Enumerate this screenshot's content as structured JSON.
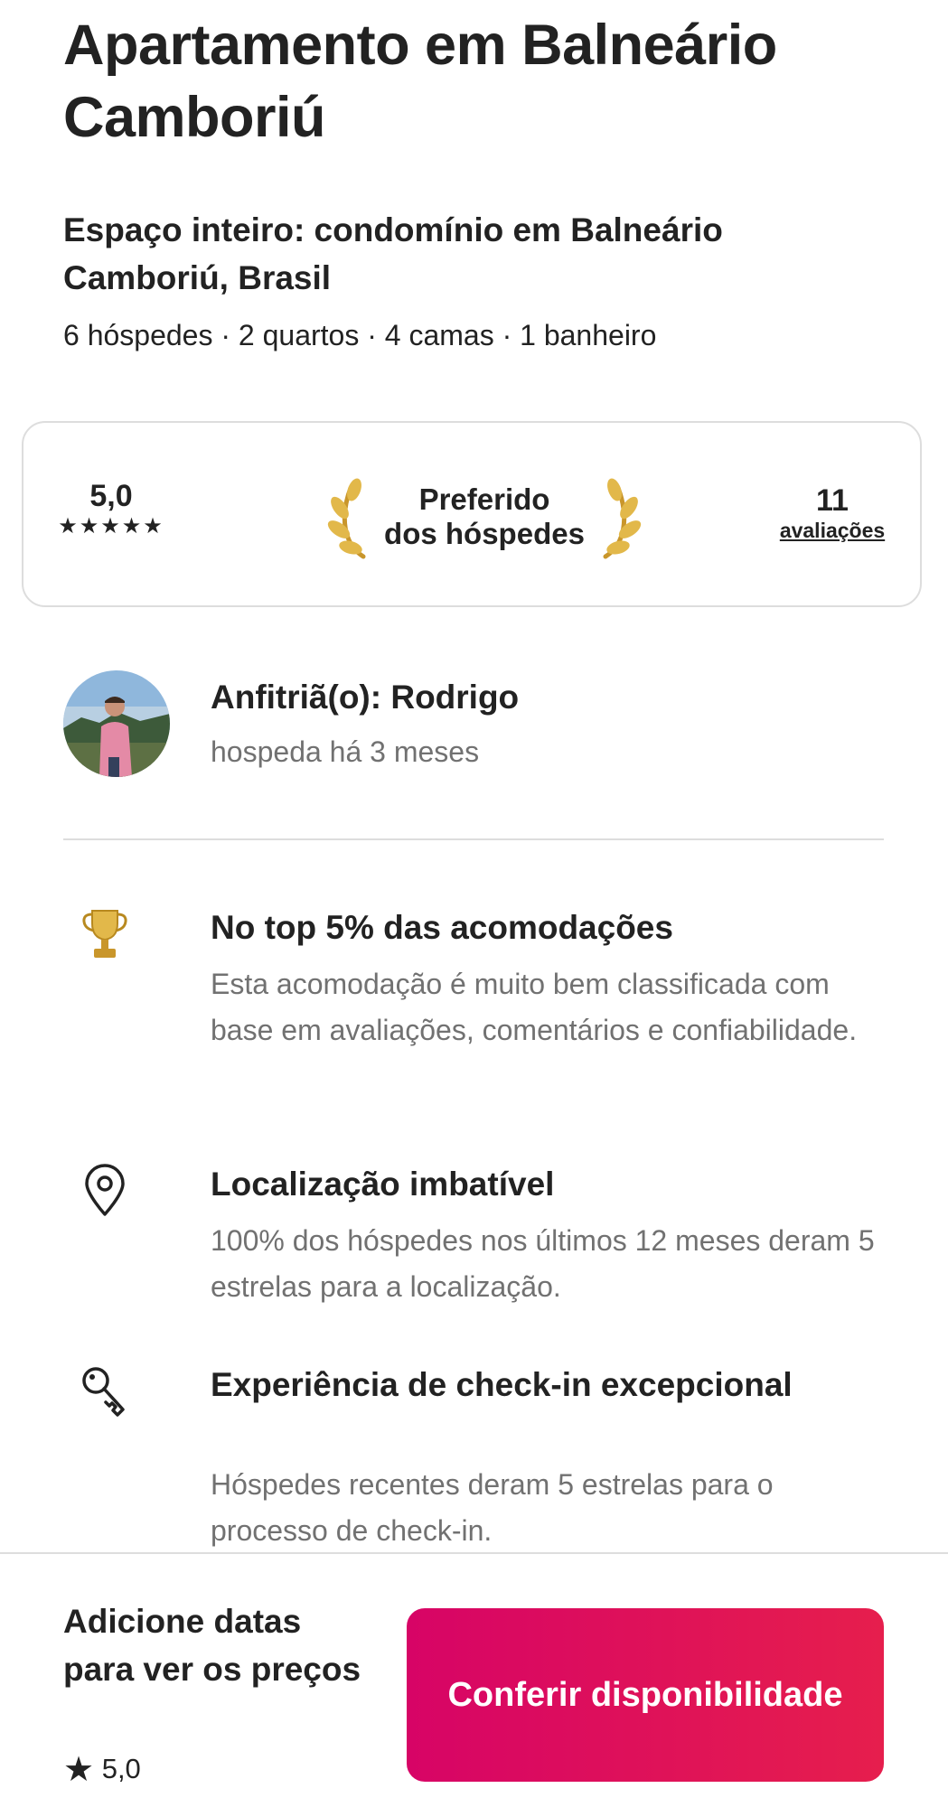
{
  "listing": {
    "title": "Apartamento em Balneário Camboriú",
    "subtitle": "Espaço inteiro: condomínio em Balneário Camboriú, Brasil",
    "details": "6 hóspedes · 2 quartos · 4 camas · 1 banheiro"
  },
  "rating_card": {
    "score": "5,0",
    "stars": "★★★★★",
    "badge_line1": "Preferido",
    "badge_line2": "dos hóspedes",
    "reviews_count": "11",
    "reviews_label": "avaliações"
  },
  "host": {
    "name": "Anfitriã(o): Rodrigo",
    "since": "hospeda há 3 meses",
    "avatar_icon": "host-avatar-photo"
  },
  "highlights": [
    {
      "icon": "trophy-icon",
      "title": "No top 5% das acomodações",
      "description": "Esta acomodação é muito bem classificada com base em avaliações, comentários e confiabilidade."
    },
    {
      "icon": "map-pin-icon",
      "title": "Localização imbatível",
      "description": "100% dos hóspedes nos últimos 12 meses deram 5 estrelas para a localização."
    },
    {
      "icon": "key-icon",
      "title": "Experiência de check-in excepcional",
      "description": "Hóspedes recentes deram 5 estrelas para o processo de check-in."
    }
  ],
  "footer": {
    "price_label": "Adicione datas para ver os preços",
    "rating_star": "★",
    "rating": "5,0",
    "cta_label": "Conferir disponibilidade"
  },
  "colors": {
    "brand": "#e61e4d",
    "brand_dark": "#d70466",
    "text": "#222222",
    "muted": "#717171",
    "gold": "#e2b84a"
  }
}
